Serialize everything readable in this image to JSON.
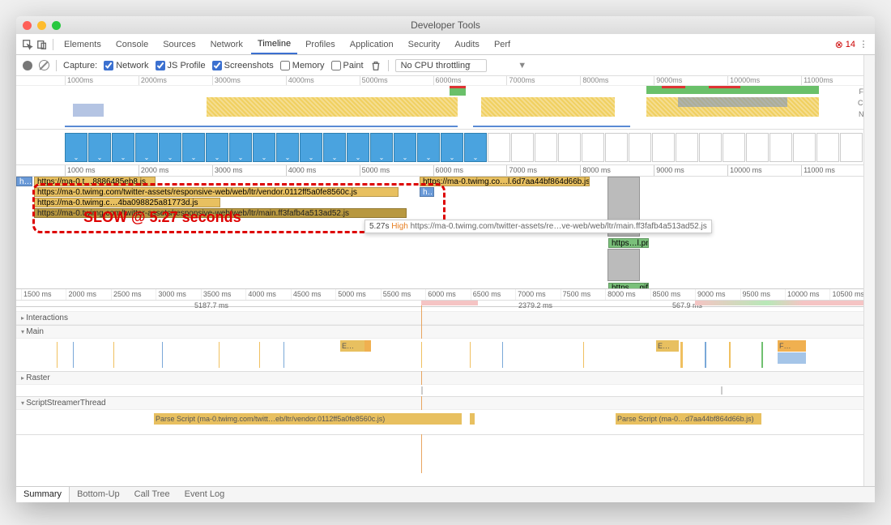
{
  "window_title": "Developer Tools",
  "tabs": [
    "Elements",
    "Console",
    "Sources",
    "Network",
    "Timeline",
    "Profiles",
    "Application",
    "Security",
    "Audits",
    "Perf"
  ],
  "active_tab": "Timeline",
  "error_count": 14,
  "toolbar": {
    "capture_label": "Capture:",
    "chk_network": "Network",
    "chk_jsprofile": "JS Profile",
    "chk_screenshots": "Screenshots",
    "chk_memory": "Memory",
    "chk_paint": "Paint",
    "throttling": "No CPU throttling"
  },
  "overview_ticks": [
    "1000ms",
    "2000ms",
    "3000ms",
    "4000ms",
    "5000ms",
    "6000ms",
    "7000ms",
    "8000ms",
    "9000ms",
    "10000ms",
    "11000ms"
  ],
  "overview_labels": [
    "FPS",
    "CPU",
    "NET"
  ],
  "ruler1": [
    "1000 ms",
    "2000 ms",
    "3000 ms",
    "4000 ms",
    "5000 ms",
    "6000 ms",
    "7000 ms",
    "8000 ms",
    "9000 ms",
    "10000 ms",
    "11000 ms"
  ],
  "network_bars": {
    "b0": "h…e",
    "b1": "https://ma-0.t…8886485eb8.js",
    "b2": "https://ma-0.twimg.com/twitter-assets/responsive-web/web/ltr/vendor.0112ff5a0fe8560c.js",
    "b3": "https://ma-0.twimg.c…4ba098825a81773d.js",
    "b4": "https://ma-0.twimg.com/twitter-assets/responsive-web/web/ltr/main.ff3fafb4a513ad52.js",
    "b5": "https://ma-0.twimg.co…l.6d7aa44bf864d66b.js",
    "b6": "h…",
    "b7": "https…l.png",
    "b8": "https….gif"
  },
  "annotation": "SLOW @ 5.27 seconds",
  "tooltip": {
    "time": "5.27s",
    "priority": "High",
    "url": "https://ma-0.twimg.com/twitter-assets/re…ve-web/web/ltr/main.ff3fafb4a513ad52.js"
  },
  "ruler2": [
    "1500 ms",
    "2000 ms",
    "2500 ms",
    "3000 ms",
    "3500 ms",
    "4000 ms",
    "4500 ms",
    "5000 ms",
    "5500 ms",
    "6000 ms",
    "6500 ms",
    "7000 ms",
    "7500 ms",
    "8000 ms",
    "8500 ms",
    "9000 ms",
    "9500 ms",
    "10000 ms",
    "10500 ms"
  ],
  "markers": {
    "m1": "5187.7 ms",
    "m2": "2379.2 ms",
    "m3": "567.9 ms"
  },
  "sections": {
    "interactions": "Interactions",
    "main": "Main",
    "raster": "Raster",
    "sst": "ScriptStreamerThread"
  },
  "main_flames": {
    "e1": "E…",
    "e2": "E…",
    "f1": "F…"
  },
  "sst_flames": {
    "p1": "Parse Script (ma-0.twimg.com/twitt…eb/ltr/vendor.0112ff5a0fe8560c.js)",
    "p2": "Parse Script (ma-0…d7aa44bf864d66b.js)"
  },
  "footer_tabs": [
    "Summary",
    "Bottom-Up",
    "Call Tree",
    "Event Log"
  ]
}
